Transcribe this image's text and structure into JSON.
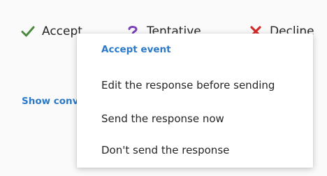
{
  "response_bar": {
    "accept_label": "Accept",
    "tentative_label": "Tentative",
    "decline_label": "Decline",
    "accept_icon": "checkmark-icon",
    "tentative_icon": "question-mark-icon",
    "decline_icon": "x-icon",
    "colors": {
      "accept": "#4b8a3e",
      "tentative": "#7a3fb8",
      "decline": "#d42a2a"
    }
  },
  "show_link_label": "Show conversation",
  "menu": {
    "header": "Accept event",
    "items": [
      {
        "label": "Edit the response before sending"
      },
      {
        "label": "Send the response now"
      },
      {
        "label": "Don't send the response"
      }
    ]
  },
  "colors": {
    "link": "#2b79c7",
    "text": "#262626",
    "background": "#fafafa",
    "menu_background": "#ffffff"
  }
}
